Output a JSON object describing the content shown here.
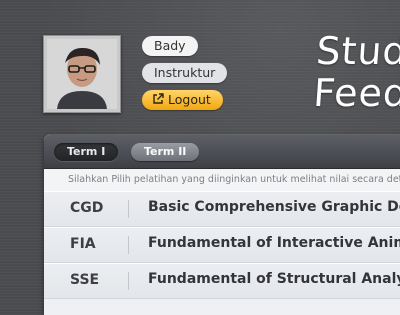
{
  "user": {
    "name": "Bady",
    "role": "Instruktur",
    "logout_label": "Logout"
  },
  "app": {
    "title": "Stud\nFeed"
  },
  "tabs": [
    {
      "label": "Term I",
      "active": true
    },
    {
      "label": "Term II",
      "active": false
    }
  ],
  "instructions": "Silahkan Pilih pelatihan yang diinginkan untuk melihat nilai secara detail",
  "courses": [
    {
      "code": "CGD",
      "title": "Basic Comprehensive Graphic Design"
    },
    {
      "code": "FIA",
      "title": "Fundamental of Interactive Animation"
    },
    {
      "code": "SSE",
      "title": "Fundamental of Structural Analysis"
    }
  ],
  "colors": {
    "background": "#4b4c50",
    "logout_accent": "#f3a70e",
    "panel": "#eef0f3"
  }
}
